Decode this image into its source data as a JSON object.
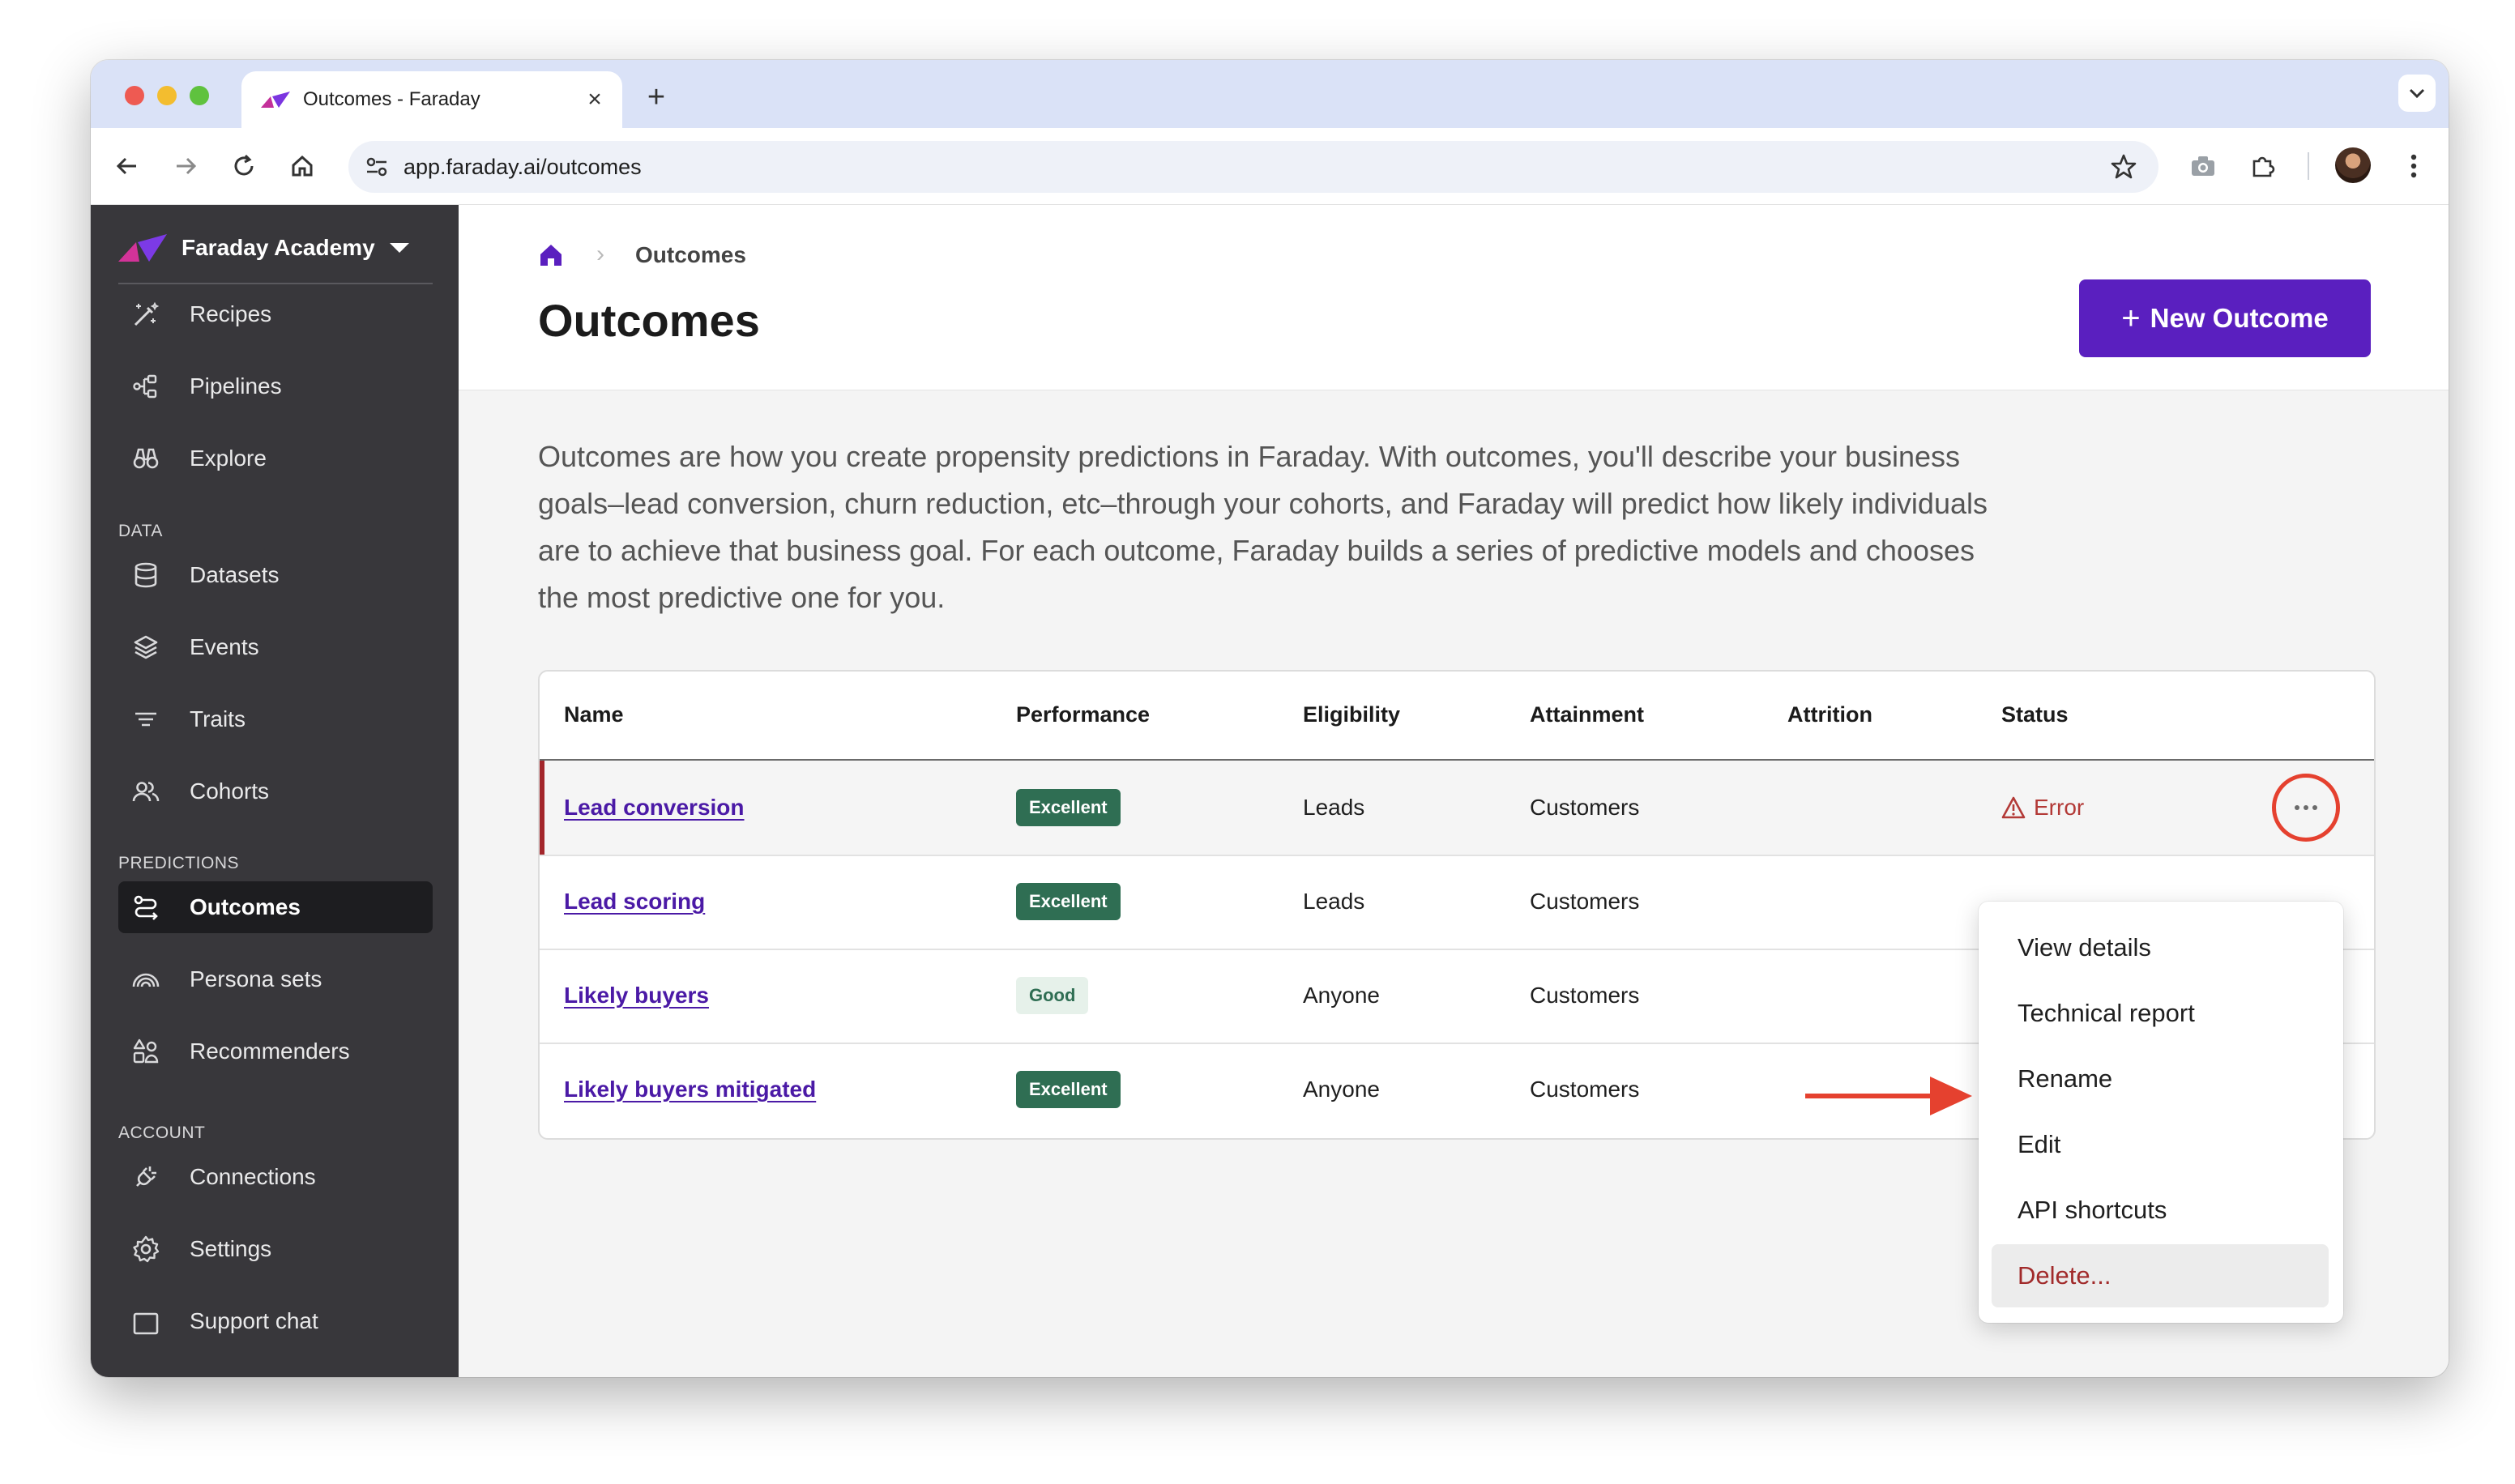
{
  "browser": {
    "tab_title": "Outcomes - Faraday",
    "url": "app.faraday.ai/outcomes"
  },
  "sidebar": {
    "org_name": "Faraday Academy",
    "main_items": [
      {
        "label": "Recipes",
        "icon": "magic-wand-icon"
      },
      {
        "label": "Pipelines",
        "icon": "pipeline-icon"
      },
      {
        "label": "Explore",
        "icon": "binoculars-icon"
      }
    ],
    "sections": [
      {
        "title": "DATA",
        "items": [
          {
            "label": "Datasets",
            "icon": "database-icon"
          },
          {
            "label": "Events",
            "icon": "layers-icon"
          },
          {
            "label": "Traits",
            "icon": "filter-lines-icon"
          },
          {
            "label": "Cohorts",
            "icon": "users-icon"
          }
        ]
      },
      {
        "title": "PREDICTIONS",
        "items": [
          {
            "label": "Outcomes",
            "icon": "outcome-icon",
            "active": true
          },
          {
            "label": "Persona sets",
            "icon": "rainbow-icon"
          },
          {
            "label": "Recommenders",
            "icon": "shapes-person-icon"
          }
        ]
      },
      {
        "title": "ACCOUNT",
        "items": [
          {
            "label": "Connections",
            "icon": "plug-icon"
          },
          {
            "label": "Settings",
            "icon": "gear-icon"
          },
          {
            "label": "Support chat",
            "icon": "chat-square-icon"
          }
        ]
      }
    ]
  },
  "page": {
    "breadcrumb_current": "Outcomes",
    "title": "Outcomes",
    "new_button_label": "New Outcome",
    "intro": "Outcomes are how you create propensity predictions in Faraday. With outcomes, you'll describe your business goals–lead conversion, churn reduction, etc–through your cohorts, and Faraday will predict how likely individuals are to achieve that business goal. For each outcome, Faraday builds a series of predictive models and chooses the most predictive one for you."
  },
  "table": {
    "headers": [
      "Name",
      "Performance",
      "Eligibility",
      "Attainment",
      "Attrition",
      "Status"
    ],
    "rows": [
      {
        "name": "Lead conversion",
        "performance": "Excellent",
        "eligibility": "Leads",
        "attainment": "Customers",
        "attrition": "",
        "status": "Error"
      },
      {
        "name": "Lead scoring",
        "performance": "Excellent",
        "eligibility": "Leads",
        "attainment": "Customers",
        "attrition": "",
        "status": ""
      },
      {
        "name": "Likely buyers",
        "performance": "Good",
        "eligibility": "Anyone",
        "attainment": "Customers",
        "attrition": "",
        "status": ""
      },
      {
        "name": "Likely buyers mitigated",
        "performance": "Excellent",
        "eligibility": "Anyone",
        "attainment": "Customers",
        "attrition": "",
        "status": ""
      }
    ]
  },
  "menu": {
    "items": [
      "View details",
      "Technical report",
      "Rename",
      "Edit",
      "API shortcuts",
      "Delete..."
    ]
  },
  "colors": {
    "accent": "#5a1fbf",
    "sidebar": "#38373b",
    "error": "#b33a37",
    "badge_excellent": "#2f6e53",
    "annotation": "#e5412f"
  }
}
